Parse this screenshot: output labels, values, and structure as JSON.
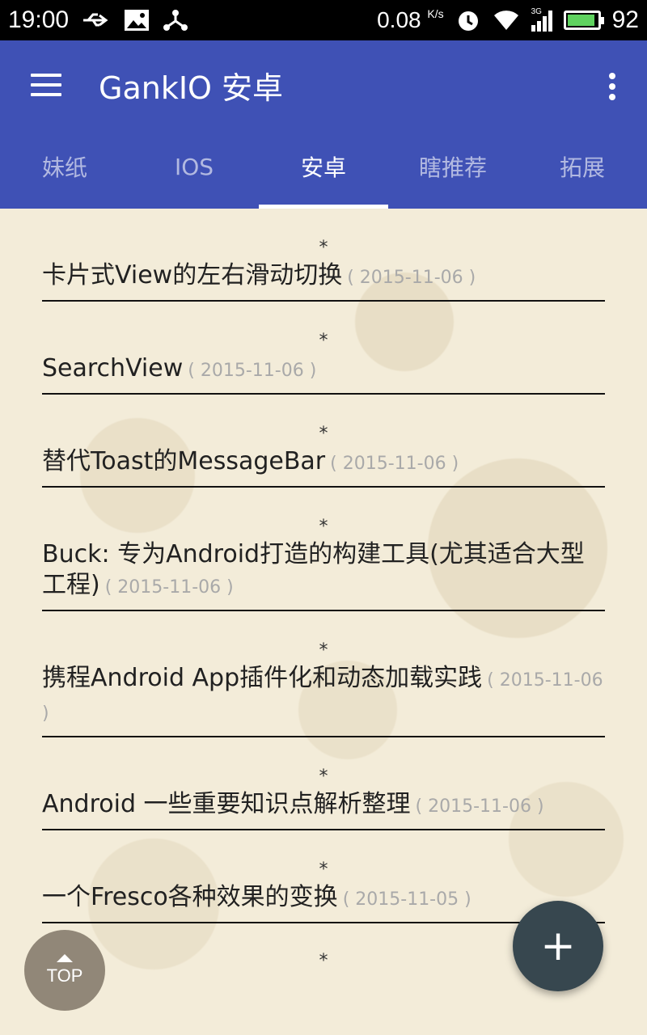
{
  "status_bar": {
    "time": "19:00",
    "net_speed": "0.08",
    "net_unit": "K/s",
    "signal": "3G",
    "battery_level": "92",
    "icons": [
      "usb-icon",
      "image-icon",
      "share-icon",
      "alarm-icon",
      "wifi-icon",
      "signal-icon",
      "battery-icon"
    ]
  },
  "toolbar": {
    "title": "GankIO 安卓"
  },
  "tabs": [
    {
      "label": "妹纸",
      "active": false
    },
    {
      "label": "IOS",
      "active": false
    },
    {
      "label": "安卓",
      "active": true
    },
    {
      "label": "瞎推荐",
      "active": false
    },
    {
      "label": "拓展",
      "active": false
    }
  ],
  "list": {
    "separator": "*",
    "items": [
      {
        "title": "卡片式View的左右滑动切换",
        "date": "( 2015-11-06 )"
      },
      {
        "title": "SearchView",
        "date": "( 2015-11-06 )"
      },
      {
        "title": "替代Toast的MessageBar",
        "date": "( 2015-11-06 )"
      },
      {
        "title": "Buck: 专为Android打造的构建工具(尤其适合大型工程)",
        "date": "( 2015-11-06 )"
      },
      {
        "title": "携程Android App插件化和动态加载实践",
        "date": "( 2015-11-06 )"
      },
      {
        "title": "Android 一些重要知识点解析整理",
        "date": "( 2015-11-06 )"
      },
      {
        "title": "一个Fresco各种效果的变换",
        "date": "( 2015-11-05 )"
      }
    ]
  },
  "fab": {
    "label": "+"
  },
  "top_button": {
    "label": "TOP"
  },
  "colors": {
    "primary": "#3f51b5",
    "fab": "#37474f",
    "background": "#f3ecd9"
  }
}
